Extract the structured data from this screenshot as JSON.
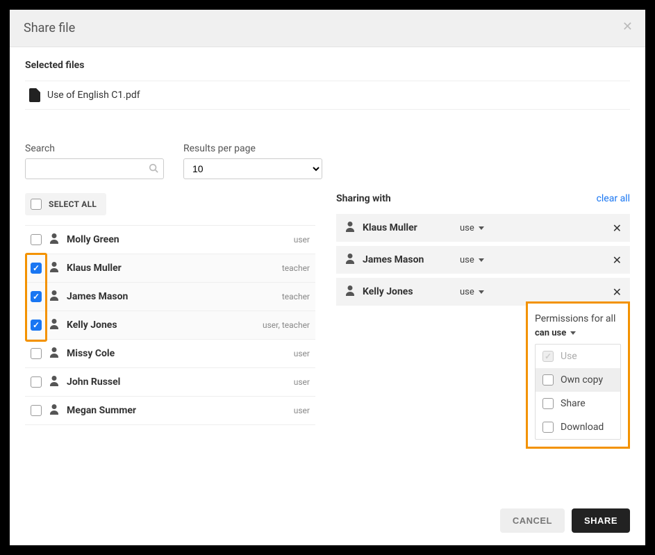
{
  "header": {
    "title": "Share file"
  },
  "selected_files": {
    "title": "Selected files",
    "items": [
      {
        "name": "Use of English C1.pdf"
      }
    ]
  },
  "search": {
    "label": "Search",
    "value": "",
    "placeholder": ""
  },
  "results_per_page": {
    "label": "Results per page",
    "value": "10"
  },
  "select_all": {
    "label": "SELECT ALL",
    "checked": false
  },
  "users": [
    {
      "name": "Molly Green",
      "role": "user",
      "checked": false
    },
    {
      "name": "Klaus Muller",
      "role": "teacher",
      "checked": true
    },
    {
      "name": "James Mason",
      "role": "teacher",
      "checked": true
    },
    {
      "name": "Kelly Jones",
      "role": "user, teacher",
      "checked": true
    },
    {
      "name": "Missy Cole",
      "role": "user",
      "checked": false
    },
    {
      "name": "John Russel",
      "role": "user",
      "checked": false
    },
    {
      "name": "Megan Summer",
      "role": "user",
      "checked": false
    }
  ],
  "sharing": {
    "title": "Sharing with",
    "clear_all": "clear all",
    "items": [
      {
        "name": "Klaus Muller",
        "permission": "use"
      },
      {
        "name": "James Mason",
        "permission": "use"
      },
      {
        "name": "Kelly Jones",
        "permission": "use"
      }
    ]
  },
  "permissions_panel": {
    "title": "Permissions for all",
    "selected": "can use",
    "options": [
      {
        "label": "Use",
        "state": "disabled-checked"
      },
      {
        "label": "Own copy",
        "state": "unchecked",
        "hover": true
      },
      {
        "label": "Share",
        "state": "unchecked"
      },
      {
        "label": "Download",
        "state": "unchecked"
      }
    ]
  },
  "footer": {
    "cancel": "CANCEL",
    "share": "SHARE"
  }
}
